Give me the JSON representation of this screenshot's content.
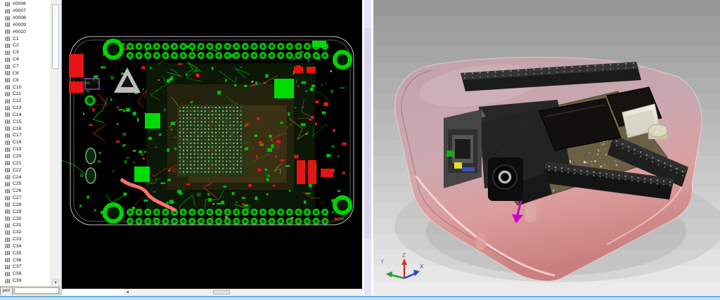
{
  "window": {
    "bottom_border_color": "#7ab2e2"
  },
  "sidebar": {
    "bottom_tab_label": "ject",
    "item_icon": "footprint-icon",
    "items": [
      "#0006",
      "#0007",
      "#0008",
      "#0009",
      "#0010",
      "C1",
      "C2",
      "C3",
      "C4",
      "C7",
      "C8",
      "C9",
      "C10",
      "C11",
      "C12",
      "C13",
      "C14",
      "C15",
      "C16",
      "C17",
      "C18",
      "C19",
      "C20",
      "C21",
      "C22",
      "C24",
      "C25",
      "C26",
      "C27",
      "C28",
      "C29",
      "C30",
      "C31",
      "C32",
      "C33",
      "C34",
      "C35",
      "C36",
      "C37",
      "C38",
      "C39"
    ]
  },
  "pcb2d": {
    "background": "#000000",
    "pad_green": "#00d400",
    "pad_red": "#ee1616",
    "outline_color": "#bdbdbd"
  },
  "viewer3d": {
    "background_top": "#979797",
    "background_bottom": "#ebebeb",
    "case_color": "#d89b9b",
    "axes": {
      "x": {
        "label": "X",
        "color": "#2848c8"
      },
      "y": {
        "label": "Y",
        "color": "#777777"
      },
      "z": {
        "label": "Z",
        "color": "#d23030"
      }
    }
  }
}
